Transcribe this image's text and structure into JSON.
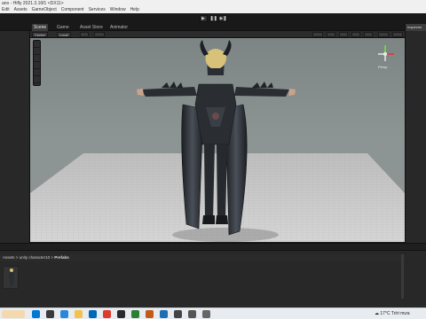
{
  "window": {
    "title": "ano - Hifly 2021.3.16f1 <DX11>"
  },
  "menu": {
    "items": [
      "Edit",
      "Assets",
      "GameObject",
      "Component",
      "Services",
      "Window",
      "Help"
    ]
  },
  "playbar": {
    "play": "▶",
    "pause": "❚❚",
    "step": "▶❚"
  },
  "tabs": {
    "scene": "Scene",
    "game": "Game",
    "asset_store": "Asset Store",
    "animator": "Animator"
  },
  "inspector_tab": "Inspector",
  "scene_toolbar": {
    "shading": "Center",
    "space": "Local",
    "persp_label": "Persp"
  },
  "project": {
    "breadcrumb_prefix": "Assets > unity character10 >",
    "breadcrumb_current": "Prefabs"
  },
  "taskbar": {
    "weather": "17°C",
    "weather_desc": "Trời mưa"
  },
  "colors": {
    "sky": "#7d8584",
    "floor": "#c9c9c9",
    "armor": "#2a2e33",
    "hair": "#d8c27a"
  }
}
